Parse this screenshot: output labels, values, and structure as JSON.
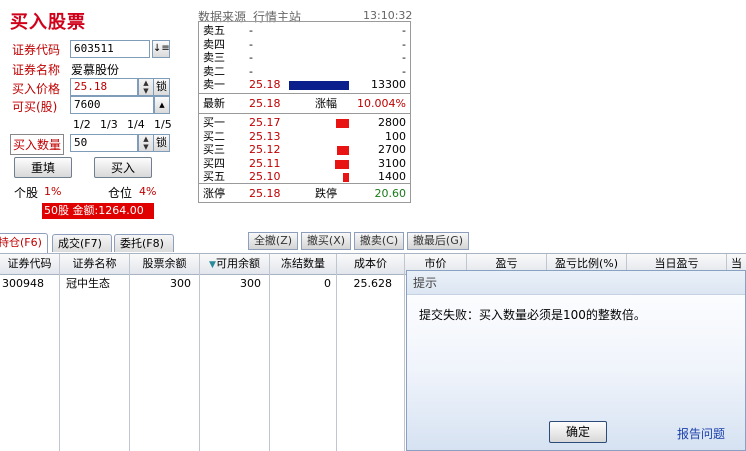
{
  "title": "买入股票",
  "form": {
    "code_label": "证券代码",
    "code_value": "603511",
    "name_label": "证券名称",
    "name_value": "爱慕股份",
    "price_label": "买入价格",
    "price_value": "25.18",
    "lock_label": "锁",
    "avail_label": "可买(股)",
    "avail_value": "7600",
    "fractions": [
      "1/2",
      "1/3",
      "1/4",
      "1/5"
    ],
    "qty_label": "买入数量",
    "qty_value": "50",
    "reset_button": "重填",
    "buy_button": "买入",
    "single_stock_label": "个股",
    "single_stock_value": "1%",
    "position_label": "仓位",
    "position_value": "4%",
    "summary": "50股 金额:1264.00"
  },
  "quote": {
    "source_label": "数据来源",
    "source_value": "行情主站",
    "time": "13:10:32",
    "asks": [
      {
        "label": "卖五",
        "price": "-",
        "vol": "-"
      },
      {
        "label": "卖四",
        "price": "-",
        "vol": "-"
      },
      {
        "label": "卖三",
        "price": "-",
        "vol": "-"
      },
      {
        "label": "卖二",
        "price": "-",
        "vol": "-"
      },
      {
        "label": "卖一",
        "price": "25.18",
        "vol": "13300",
        "bar_fraction": 1.0
      }
    ],
    "latest_label": "最新",
    "latest_value": "25.18",
    "change_label": "涨幅",
    "change_value": "10.004%",
    "bids": [
      {
        "label": "买一",
        "price": "25.17",
        "vol": "2800",
        "bar_fraction": 0.21
      },
      {
        "label": "买二",
        "price": "25.13",
        "vol": "100",
        "bar_fraction": 0.0
      },
      {
        "label": "买三",
        "price": "25.12",
        "vol": "2700",
        "bar_fraction": 0.2
      },
      {
        "label": "买四",
        "price": "25.11",
        "vol": "3100",
        "bar_fraction": 0.23
      },
      {
        "label": "买五",
        "price": "25.10",
        "vol": "1400",
        "bar_fraction": 0.1
      }
    ],
    "limit_up_label": "涨停",
    "limit_up_value": "25.18",
    "limit_down_label": "跌停",
    "limit_down_value": "20.60"
  },
  "colors": {
    "ask_bar": "#0a1e8c",
    "bid_bar": "#e81414",
    "accent": "#c00000"
  },
  "tabs": [
    "持仓(F6)",
    "成交(F7)",
    "委托(F8)"
  ],
  "actions": [
    "全撤(Z)",
    "撤买(X)",
    "撤卖(C)",
    "撤最后(G)"
  ],
  "table": {
    "headers": [
      "证券代码",
      "证券名称",
      "股票余额",
      "可用余额",
      "冻结数量",
      "成本价",
      "市价",
      "盈亏",
      "盈亏比例(%)",
      "当日盈亏",
      "当"
    ],
    "rows": [
      [
        "300948",
        "冠中生态",
        "300",
        "300",
        "0",
        "25.628"
      ]
    ]
  },
  "dialog": {
    "title": "提示",
    "message": "提交失败：买入数量必须是100的整数倍。",
    "ok_button": "确定",
    "report_link": "报告问题"
  }
}
